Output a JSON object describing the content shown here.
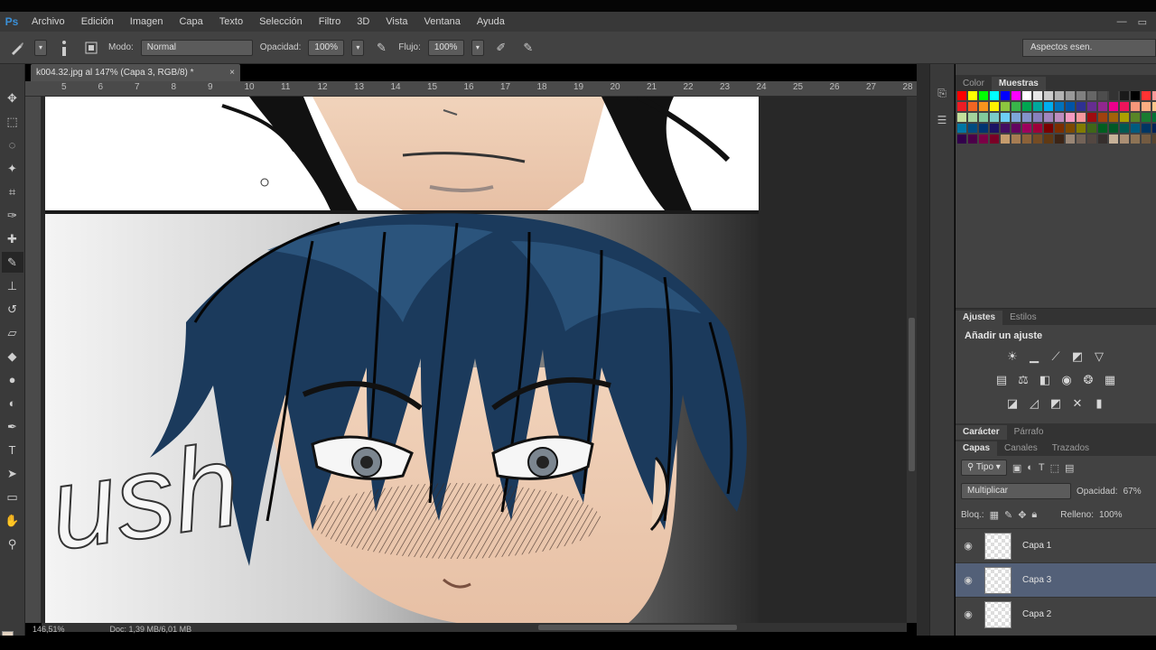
{
  "app": {
    "logo": "Ps",
    "menu": [
      "Archivo",
      "Edición",
      "Imagen",
      "Capa",
      "Texto",
      "Selección",
      "Filtro",
      "3D",
      "Vista",
      "Ventana",
      "Ayuda"
    ],
    "window_controls": [
      "—",
      "▭"
    ]
  },
  "options": {
    "mode_label": "Modo:",
    "mode_value": "Normal",
    "opacity_label": "Opacidad:",
    "opacity_value": "100%",
    "flow_label": "Flujo:",
    "flow_value": "100%",
    "workspace": "Aspectos esen."
  },
  "document": {
    "tab_title": "k004.32.jpg al 147% (Capa 3, RGB/8) *",
    "ruler_ticks": [
      "5",
      "6",
      "7",
      "8",
      "9",
      "10",
      "11",
      "12",
      "13",
      "14",
      "15",
      "16",
      "17",
      "18",
      "19",
      "20",
      "21",
      "22",
      "23",
      "24",
      "25",
      "26",
      "27",
      "28"
    ],
    "zoom": "146,51%",
    "doc_size": "Doc: 1,39 MB/6,01 MB",
    "sfx_text": "ush"
  },
  "panels": {
    "color_tab": "Color",
    "swatches_tab": "Muestras",
    "adjust_tab": "Ajustes",
    "styles_tab": "Estilos",
    "adjust_title": "Añadir un ajuste",
    "character_tab": "Carácter",
    "paragraph_tab": "Párrafo",
    "layers_tab": "Capas",
    "channels_tab": "Canales",
    "paths_tab": "Trazados",
    "kind_filter": "Tipo",
    "blend_mode": "Multiplicar",
    "layer_opacity_label": "Opacidad:",
    "layer_opacity_value": "67%",
    "lock_label": "Bloq.:",
    "fill_label": "Relleno:",
    "fill_value": "100%",
    "layers": [
      {
        "name": "Capa 1",
        "selected": false
      },
      {
        "name": "Capa 3",
        "selected": true
      },
      {
        "name": "Capa 2",
        "selected": false
      }
    ]
  },
  "swatch_colors": [
    "#ff0000",
    "#ffff00",
    "#00ff00",
    "#00ffff",
    "#0000ff",
    "#ff00ff",
    "#ffffff",
    "#e6e6e6",
    "#cccccc",
    "#b3b3b3",
    "#999999",
    "#808080",
    "#666666",
    "#4d4d4d",
    "#333333",
    "#1a1a1a",
    "#000000",
    "#ff3333",
    "#ff9999",
    "#ffcc99",
    "#ed1c24",
    "#f26522",
    "#f7941d",
    "#fff200",
    "#8dc63f",
    "#39b54a",
    "#00a651",
    "#00a99d",
    "#00aeef",
    "#0072bc",
    "#0054a6",
    "#2e3192",
    "#662d91",
    "#92278f",
    "#ec008c",
    "#ed145b",
    "#f7977a",
    "#fbad82",
    "#fdc68a",
    "#fff799",
    "#c4df9b",
    "#a3d39c",
    "#82ca9c",
    "#7accc8",
    "#6dcff6",
    "#7da7d9",
    "#8393ca",
    "#8781bd",
    "#a186be",
    "#bd8cbf",
    "#f49ac1",
    "#f6989d",
    "#9e0b0f",
    "#a0410d",
    "#a36209",
    "#aba000",
    "#598527",
    "#1a7b30",
    "#007236",
    "#00746b",
    "#0076a3",
    "#004b80",
    "#003471",
    "#1b1464",
    "#440e62",
    "#630460",
    "#9e005d",
    "#9e0039",
    "#790000",
    "#7b2e00",
    "#7d4900",
    "#827b00",
    "#406618",
    "#005e20",
    "#005826",
    "#005952",
    "#005b7f",
    "#003663",
    "#002157",
    "#0d004c",
    "#32004b",
    "#4b0049",
    "#7b0046",
    "#7a0026",
    "#c69c6d",
    "#a67c52",
    "#8c6239",
    "#754c24",
    "#603913",
    "#3c2415",
    "#998675",
    "#736357",
    "#534741",
    "#362f2d",
    "#c7b299",
    "#aa8f74",
    "#8d7355",
    "#735b41",
    "#594530",
    "#3d2e20"
  ]
}
